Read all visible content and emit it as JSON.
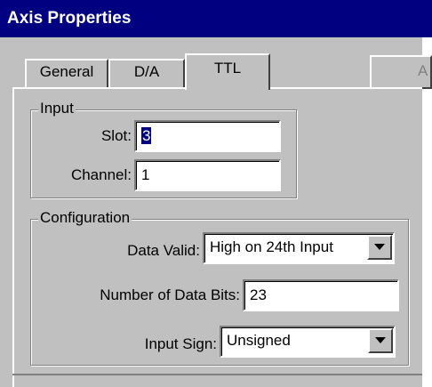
{
  "window": {
    "title": "Axis Properties",
    "right_button_label": "A"
  },
  "tabs": [
    {
      "label": "General",
      "active": false
    },
    {
      "label": "D/A",
      "active": false
    },
    {
      "label": "TTL",
      "active": true
    }
  ],
  "input_group": {
    "legend": "Input",
    "slot": {
      "label": "Slot:",
      "value": "3"
    },
    "channel": {
      "label": "Channel:",
      "value": "1"
    }
  },
  "configuration_group": {
    "legend": "Configuration",
    "data_valid": {
      "label": "Data Valid:",
      "selected": "High on 24th Input"
    },
    "number_of_data_bits": {
      "label": "Number of Data Bits:",
      "value": "23"
    },
    "input_sign": {
      "label": "Input Sign:",
      "selected": "Unsigned"
    }
  },
  "icons": {
    "dropdown_arrow": "chevron-down-icon"
  }
}
